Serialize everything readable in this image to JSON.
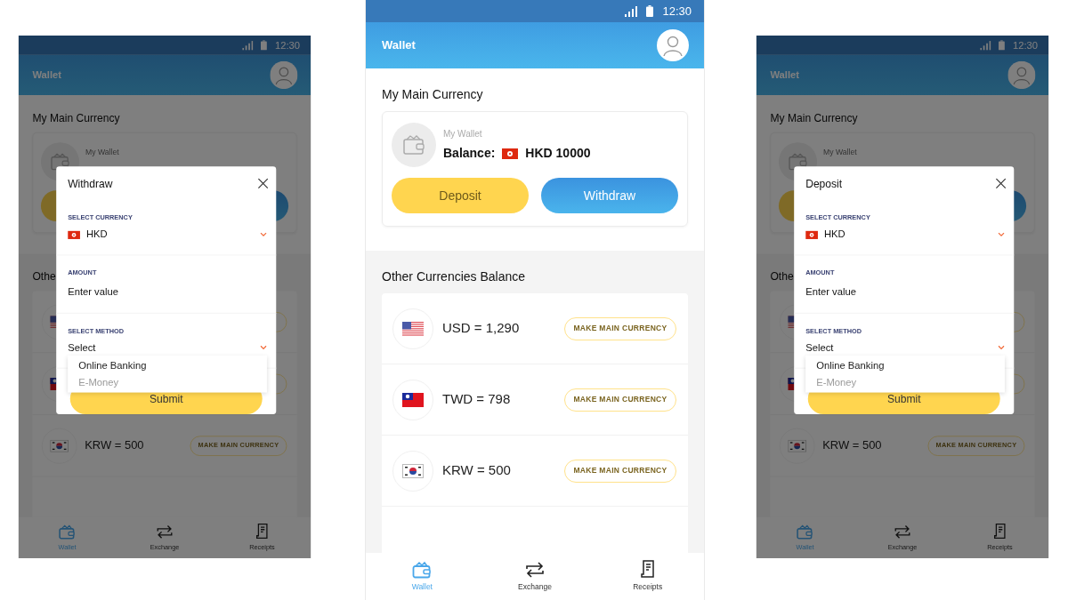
{
  "phones": [
    {
      "status": {
        "time": "12:30"
      },
      "app_bar": {
        "title": "Wallet"
      },
      "main": {
        "title": "My Main Currency",
        "wallet_label": "My Wallet",
        "buttons": [
          {
            "kind": "deposit"
          },
          {
            "kind": "withdraw"
          }
        ]
      },
      "others": {
        "title": "Othe",
        "rows": [
          {
            "kind": "us"
          },
          {
            "kind": "tw"
          },
          {
            "kind": "kr",
            "amount": "KRW = 500",
            "button": "MAKE MAIN CURRENCY"
          }
        ]
      },
      "nav": [
        {
          "label": "Wallet",
          "selected": true
        },
        {
          "label": "Exchange",
          "selected": false
        },
        {
          "label": "Receipts",
          "selected": false
        }
      ],
      "modal": {
        "title": "Withdraw",
        "fields": [
          {
            "kind": "currency",
            "label": "SELECT CURRENCY",
            "value": "HKD"
          },
          {
            "kind": "input",
            "label": "AMOUNT",
            "placeholder": "Enter value"
          },
          {
            "kind": "select",
            "label": "SELECT METHOD",
            "value": "Select",
            "expanded": true,
            "options": [
              {
                "label": "Online Banking",
                "disabled": false
              },
              {
                "label": "E-Money",
                "disabled": true
              }
            ]
          }
        ],
        "submit": "Submit"
      }
    },
    {
      "status": {
        "time": "12:30"
      },
      "app_bar": {
        "title": "Wallet"
      },
      "main": {
        "title": "My Main Currency",
        "wallet_label": "My Wallet",
        "balance_label": "Balance:",
        "balance": "HKD 10000",
        "buttons": [
          {
            "kind": "deposit",
            "label": "Deposit"
          },
          {
            "kind": "withdraw",
            "label": "Withdraw"
          }
        ]
      },
      "others": {
        "title": "Other Currencies Balance",
        "rows": [
          {
            "kind": "us",
            "amount": "USD = 1,290",
            "button": "MAKE MAIN CURRENCY"
          },
          {
            "kind": "tw",
            "amount": "TWD = 798",
            "button": "MAKE MAIN CURRENCY"
          },
          {
            "kind": "kr",
            "amount": "KRW = 500",
            "button": "MAKE MAIN CURRENCY"
          }
        ]
      },
      "nav": [
        {
          "label": "Wallet",
          "selected": true
        },
        {
          "label": "Exchange",
          "selected": false
        },
        {
          "label": "Receipts",
          "selected": false
        }
      ]
    },
    {
      "status": {
        "time": "12:30"
      },
      "app_bar": {
        "title": "Wallet"
      },
      "main": {
        "title": "My Main Currency",
        "wallet_label": "My Wallet",
        "buttons": [
          {
            "kind": "deposit"
          },
          {
            "kind": "withdraw"
          }
        ]
      },
      "others": {
        "title": "Othe",
        "rows": [
          {
            "kind": "us"
          },
          {
            "kind": "tw"
          },
          {
            "kind": "kr",
            "amount": "KRW = 500",
            "button": "MAKE MAIN CURRENCY"
          }
        ]
      },
      "nav": [
        {
          "label": "Wallet",
          "selected": true
        },
        {
          "label": "Exchange",
          "selected": false
        },
        {
          "label": "Receipts",
          "selected": false
        }
      ],
      "modal": {
        "title": "Deposit",
        "fields": [
          {
            "kind": "currency",
            "label": "SELECT CURRENCY",
            "value": "HKD"
          },
          {
            "kind": "input",
            "label": "AMOUNT",
            "placeholder": "Enter value"
          },
          {
            "kind": "select",
            "label": "SELECT METHOD",
            "value": "Select",
            "expanded": true,
            "options": [
              {
                "label": "Online Banking",
                "disabled": false
              },
              {
                "label": "E-Money",
                "disabled": true
              }
            ]
          }
        ],
        "submit": "Submit"
      }
    }
  ]
}
